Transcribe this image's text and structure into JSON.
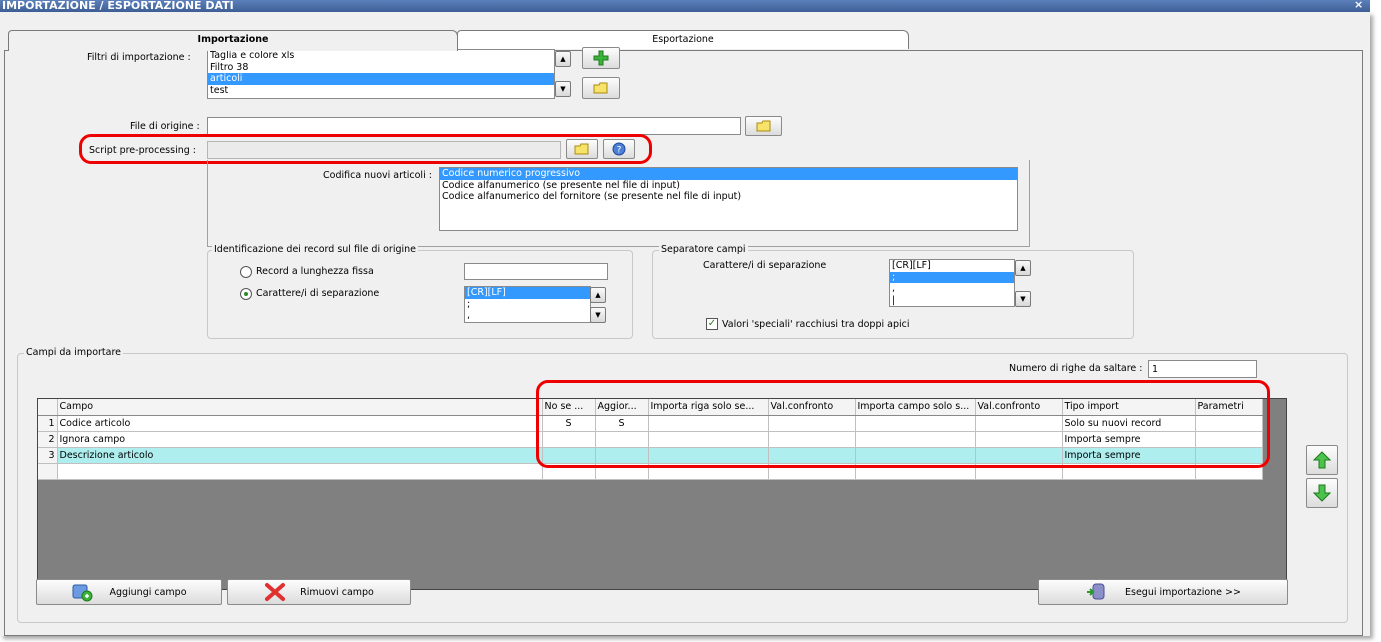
{
  "window": {
    "title": "IMPORTAZIONE / ESPORTAZIONE DATI",
    "close_glyph": "×"
  },
  "tabs": [
    {
      "label": "Importazione",
      "active": true
    },
    {
      "label": "Esportazione",
      "active": false
    }
  ],
  "filters": {
    "label": "Filtri di importazione :",
    "items": [
      "Taglia e colore xls",
      "Filtro 38",
      "articoli",
      "test"
    ],
    "selected_index": 2
  },
  "source_file": {
    "label": "File di origine :",
    "value": ""
  },
  "script": {
    "label": "Script pre-processing :",
    "value": ""
  },
  "codifica": {
    "label": "Codifica nuovi articoli :",
    "options": [
      "Codice numerico progressivo",
      "Codice alfanumerico (se presente nel file di input)",
      "Codice alfanumerico del fornitore (se presente nel file di input)"
    ],
    "selected_index": 0
  },
  "record_id": {
    "title": "Identificazione dei record sul file di origine",
    "fixed_label": "Record a lunghezza fissa",
    "fixed_value": "",
    "sep_label": "Carattere/i di separazione",
    "selected": "separator",
    "sep_items": [
      "[CR][LF]",
      ";",
      ","
    ],
    "sep_selected_index": 0
  },
  "field_sep": {
    "title": "Separatore campi",
    "label": "Carattere/i di separazione",
    "items": [
      "[CR][LF]",
      ";",
      ",",
      "|"
    ],
    "selected_index": 1,
    "quote_label": "Valori 'speciali' racchiusi tra doppi apici",
    "quote_checked": true,
    "check_glyph": "✓"
  },
  "fields": {
    "title": "Campi da importare",
    "skip_label": "Numero di righe da saltare :",
    "skip_value": "1",
    "columns": [
      "Campo",
      "No se ...",
      "Aggior...",
      "Importa riga solo se...",
      "Val.confronto",
      "Importa campo solo s...",
      "Val.confronto",
      "Tipo import",
      "Parametri"
    ],
    "rows": [
      {
        "n": "1",
        "campo": "Codice articolo",
        "nose": "S",
        "aggior": "S",
        "riga": "",
        "val1": "",
        "campo2": "",
        "val2": "",
        "tipo": "Solo su nuovi record",
        "param": ""
      },
      {
        "n": "2",
        "campo": "Ignora campo",
        "nose": "",
        "aggior": "",
        "riga": "",
        "val1": "",
        "campo2": "",
        "val2": "",
        "tipo": "Importa sempre",
        "param": ""
      },
      {
        "n": "3",
        "campo": "Descrizione articolo",
        "nose": "",
        "aggior": "",
        "riga": "",
        "val1": "",
        "campo2": "",
        "val2": "",
        "tipo": "Importa sempre",
        "param": ""
      }
    ],
    "highlight_row": 2
  },
  "buttons": {
    "add_field": "Aggiungi campo",
    "remove_field": "Rimuovi campo",
    "run_import": "Esegui importazione >>"
  },
  "colors": {
    "highlight": "#e00000",
    "selection": "#3399ff",
    "row_highlight": "#aeeeee",
    "grid_bg": "#808080"
  },
  "icons": [
    "plus-icon",
    "folder-icon",
    "help-icon",
    "arrow-up-icon",
    "arrow-down-icon",
    "add-field-icon",
    "remove-x-icon",
    "run-import-icon"
  ]
}
